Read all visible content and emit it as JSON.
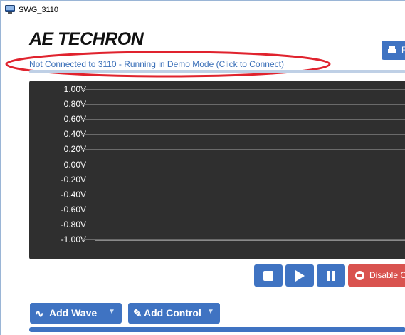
{
  "window": {
    "title": "SWG_3110"
  },
  "header": {
    "logo_text": "AE TECHRON",
    "right_button_label": "F",
    "status_link": "Not Connected to 3110 - Running in Demo Mode (Click to Connect)"
  },
  "scope": {
    "y_ticks": [
      "1.00V",
      "0.80V",
      "0.60V",
      "0.40V",
      "0.20V",
      "0.00V",
      "-0.20V",
      "-0.40V",
      "-0.60V",
      "-0.80V",
      "-1.00V"
    ]
  },
  "controls": {
    "stop": "stop",
    "play": "play",
    "pause": "pause",
    "disable_label": "Disable C"
  },
  "toolbar": {
    "add_wave_label": "Add Wave",
    "add_control_label": "Add Control"
  },
  "colors": {
    "accent": "#3f73c2",
    "danger": "#d9534f",
    "scope_bg": "#2f2f2f",
    "annotation": "#e0232e",
    "link": "#3a6fb8"
  }
}
